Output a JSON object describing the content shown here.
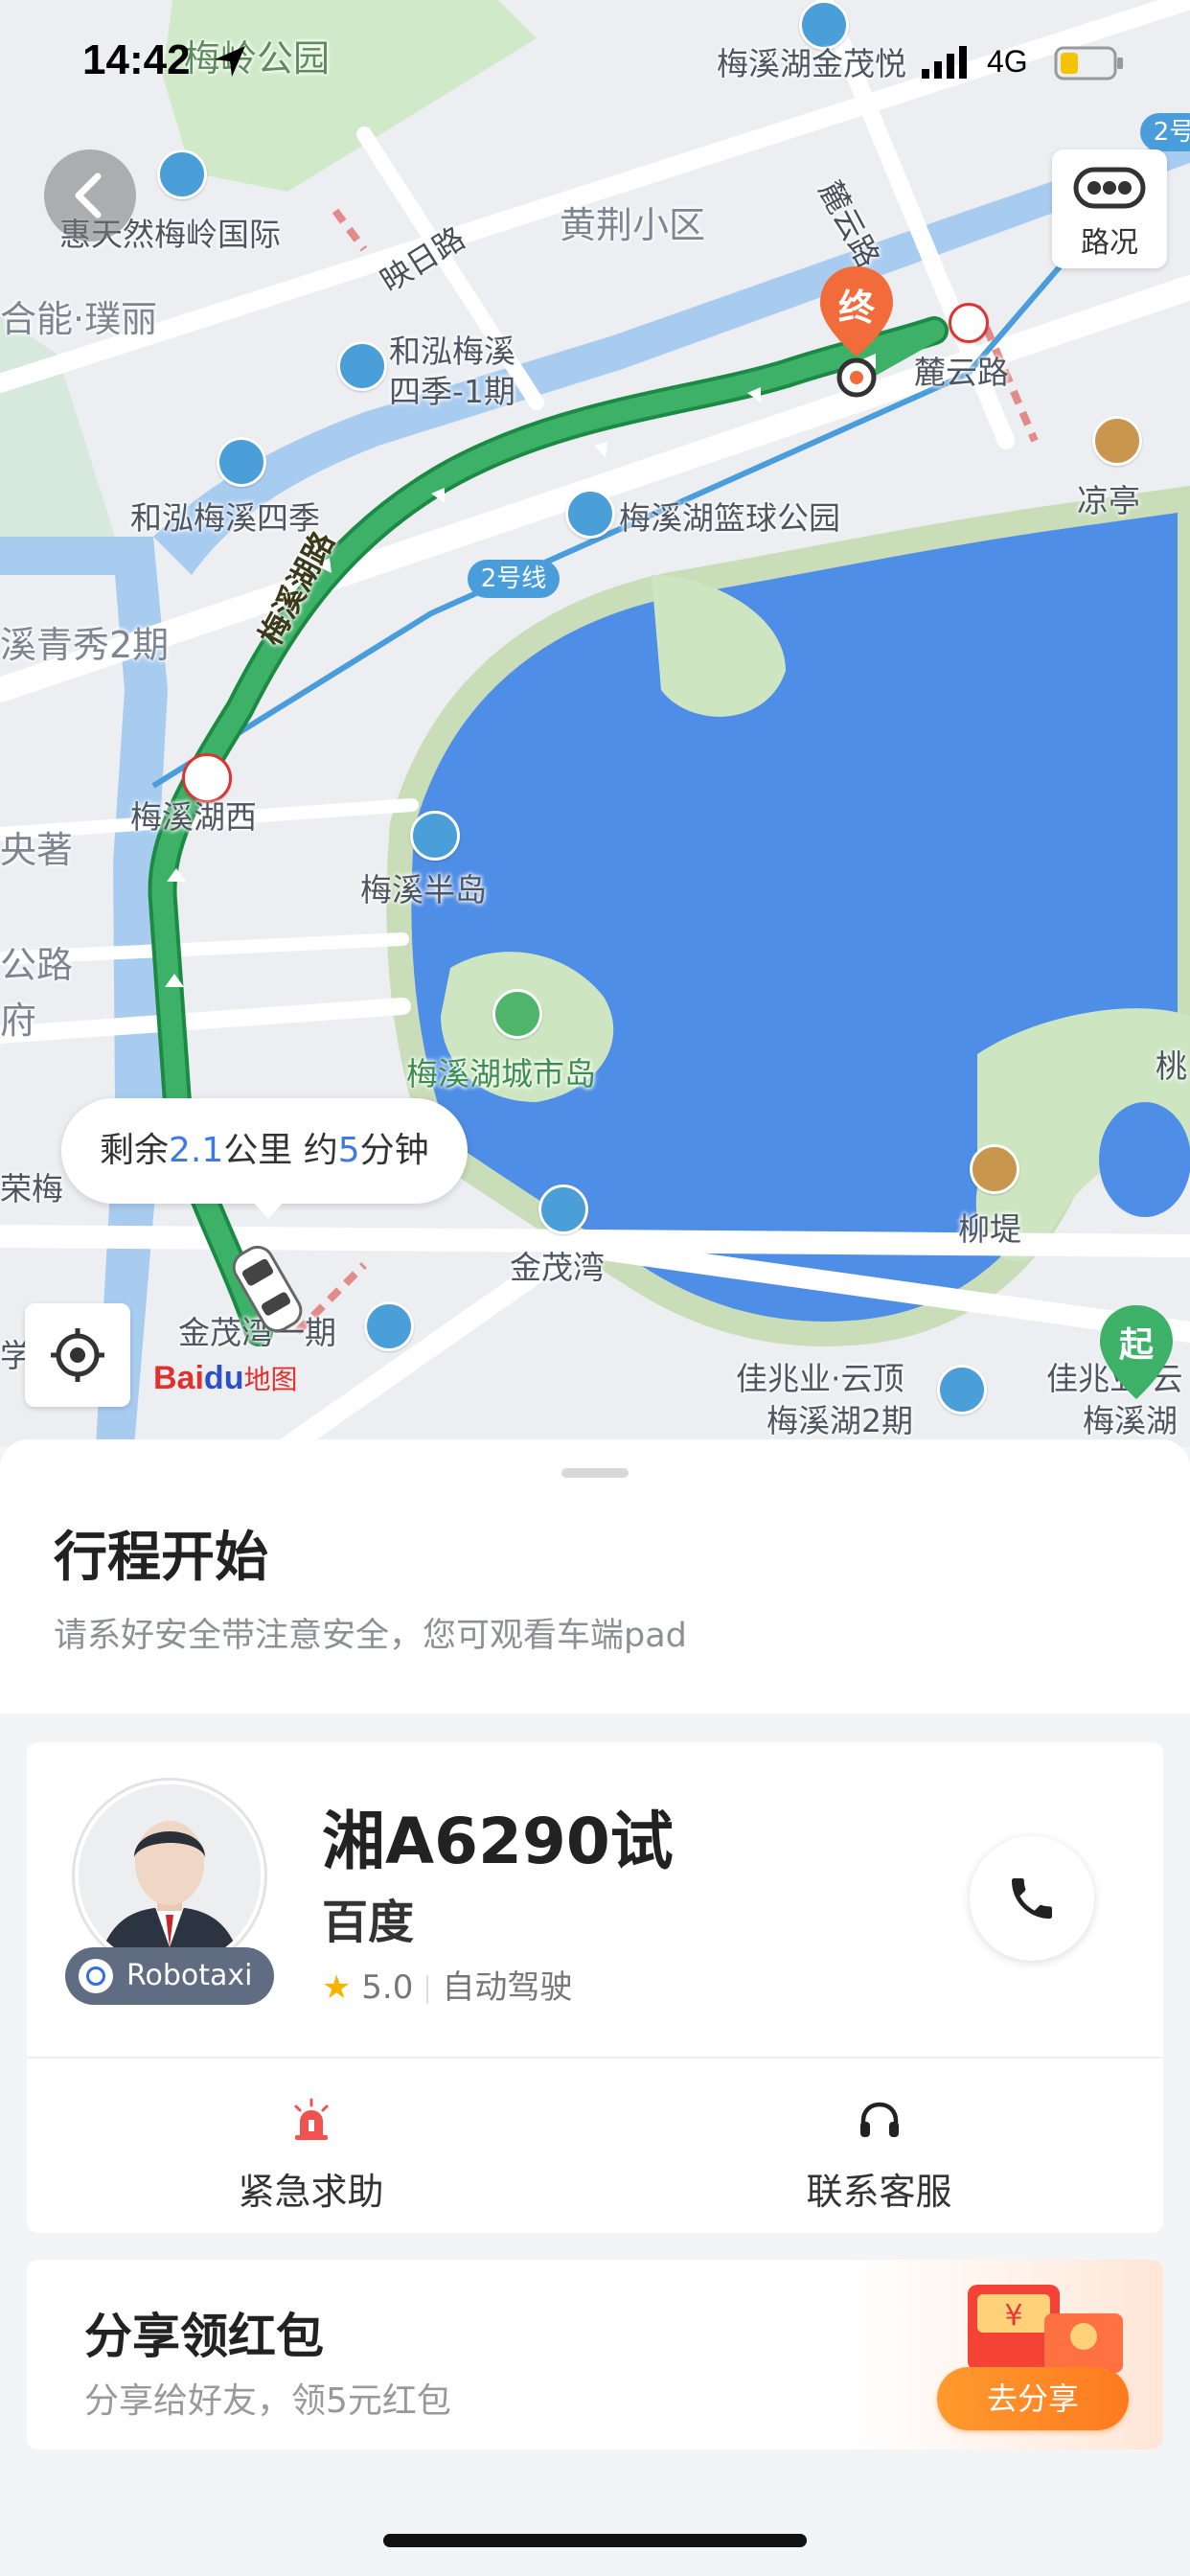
{
  "status_bar": {
    "time": "14:42",
    "network": "4G"
  },
  "map": {
    "traffic_label": "路况",
    "labels": {
      "meiling_park": "梅岭公园",
      "jinmao_yue": "梅溪湖金茂悦",
      "tianran": "惠天然梅岭国际",
      "yingri_road": "映日路",
      "huangjing": "黄荆小区",
      "luyun_road_v": "麓云路",
      "heneng": "合能·璞丽",
      "hehong_1": "和泓梅溪",
      "hehong_1b": "四季-1期",
      "luyun_station": "麓云路",
      "liangting": "凉亭",
      "hehong_4": "和泓梅溪四季",
      "basketball": "梅溪湖篮球公园",
      "line2": "2号线",
      "line2_top": "2号",
      "qingxiu": "溪青秀2期",
      "meixi_road": "梅溪湖路",
      "meixihu_west": "梅溪湖西",
      "bandao": "梅溪半岛",
      "xiaozhu": "央著",
      "lu": "公路",
      "fu": "府",
      "chengshidao": "梅溪湖城市岛",
      "liudi": "柳堤",
      "tao": "桃",
      "rongmei": "荣梅",
      "jinmaowan": "金茂湾",
      "jinmaowan1": "金茂湾一期",
      "jiazhaoye": "佳兆业·云顶",
      "jiazhaoye2": "梅溪湖2期",
      "jiazhaoye_r": "佳兆业·云",
      "jiazhaoye_r2": "梅溪湖",
      "xue": "学",
      "start_marker": "起",
      "end_marker": "终"
    },
    "eta": {
      "prefix": "剩余",
      "distance": "2.1",
      "mid": "公里 约",
      "minutes": "5",
      "suffix": "分钟"
    },
    "logo": {
      "bai": "Bai",
      "du": "du",
      "ditu": "地图"
    }
  },
  "trip": {
    "title": "行程开始",
    "subtitle": "请系好安全带注意安全，您可观看车端pad"
  },
  "driver_card": {
    "badge": "Robotaxi",
    "plate": "湘A6290试",
    "company": "百度",
    "rating": "5.0",
    "tag": "自动驾驶",
    "actions": {
      "emergency": "紧急求助",
      "service": "联系客服"
    }
  },
  "share_card": {
    "title": "分享领红包",
    "subtitle": "分享给好友，领5元红包",
    "button": "去分享"
  },
  "colors": {
    "route": "#3eb168",
    "water": "#4f8ee6",
    "accent": "#3d7be3",
    "share": "#ff8426"
  }
}
